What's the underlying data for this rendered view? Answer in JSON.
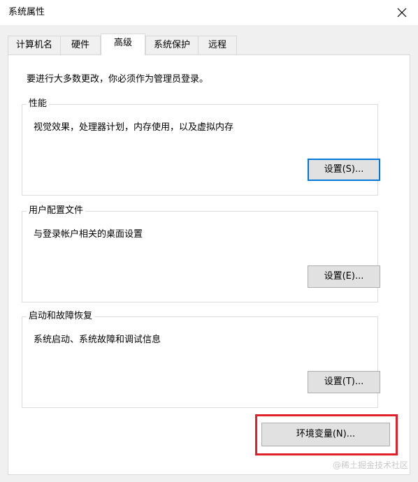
{
  "window": {
    "title": "系统属性",
    "close_icon": "close-icon"
  },
  "tabs": [
    {
      "label": "计算机名",
      "active": false
    },
    {
      "label": "硬件",
      "active": false
    },
    {
      "label": "高级",
      "active": true
    },
    {
      "label": "系统保护",
      "active": false
    },
    {
      "label": "远程",
      "active": false
    }
  ],
  "panel": {
    "notice": "要进行大多数更改，你必须作为管理员登录。",
    "groups": [
      {
        "title": "性能",
        "description": "视觉效果，处理器计划，内存使用，以及虚拟内存",
        "button": "设置(S)..."
      },
      {
        "title": "用户配置文件",
        "description": "与登录帐户相关的桌面设置",
        "button": "设置(E)..."
      },
      {
        "title": "启动和故障恢复",
        "description": "系统启动、系统故障和调试信息",
        "button": "设置(T)..."
      }
    ],
    "env_button": "环境变量(N)..."
  },
  "watermark": "@稀土掘金技术社区",
  "colors": {
    "focus_border": "#0078d7",
    "highlight_red": "#e0202a",
    "button_face": "#e1e1e1"
  }
}
